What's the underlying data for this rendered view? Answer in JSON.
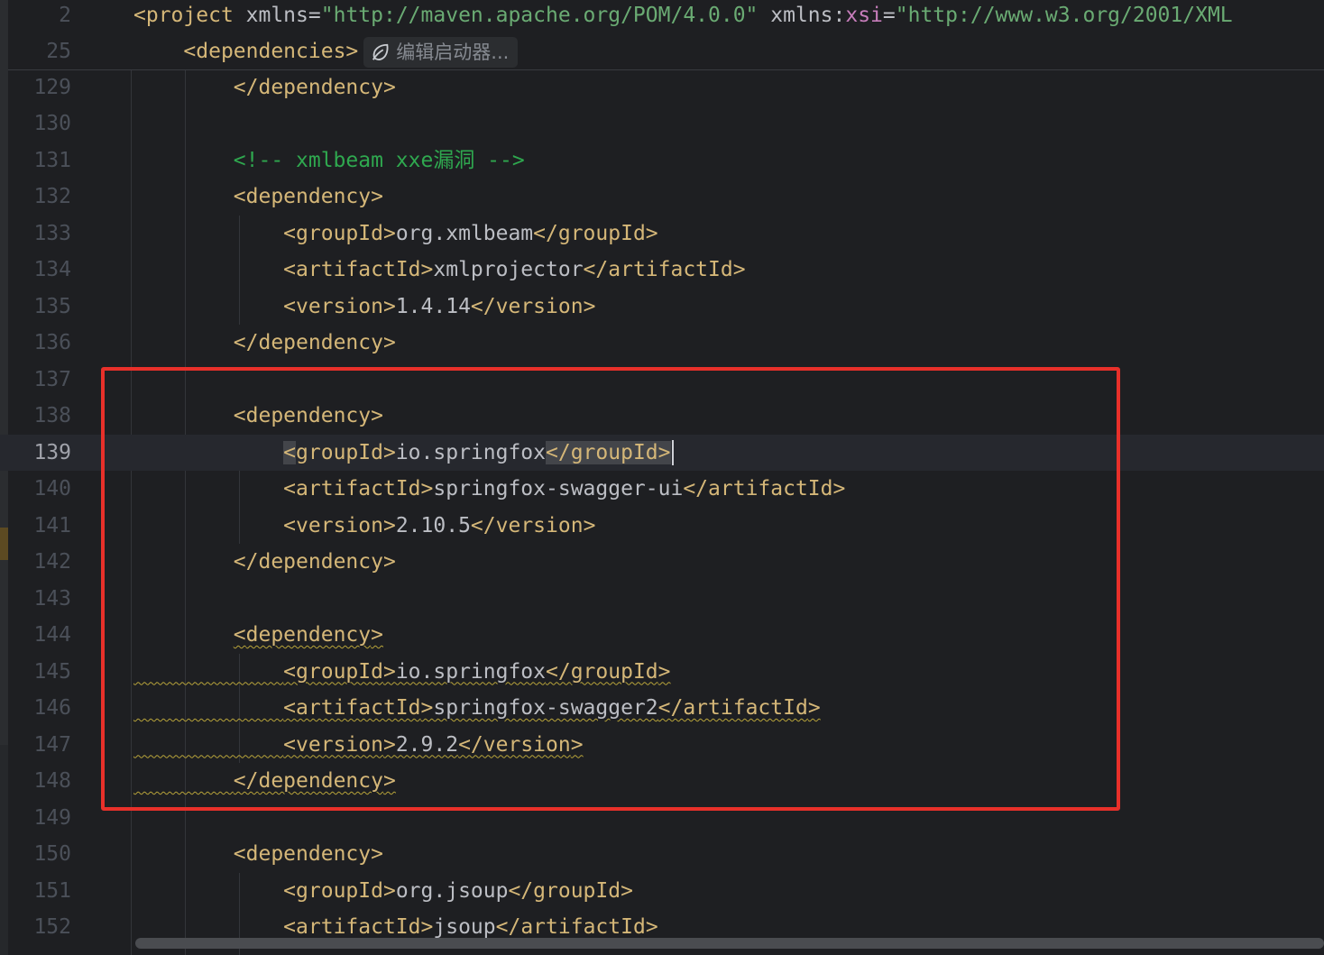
{
  "editor": {
    "sticky_lines": [
      {
        "line_number": "2",
        "tokens": [
          {
            "text": "<",
            "cls": "br"
          },
          {
            "text": "project",
            "cls": "tag"
          },
          {
            "text": " xmlns",
            "cls": "attr"
          },
          {
            "text": "=",
            "cls": "attr"
          },
          {
            "text": "\"http://maven.apache.org/POM/4.0.0\"",
            "cls": "str"
          },
          {
            "text": " xmlns",
            "cls": "attr"
          },
          {
            "text": ":",
            "cls": "attr"
          },
          {
            "text": "xsi",
            "cls": "ns"
          },
          {
            "text": "=",
            "cls": "attr"
          },
          {
            "text": "\"http://www.w3.org/2001/XML",
            "cls": "str"
          }
        ]
      },
      {
        "line_number": "25",
        "indent": "    ",
        "tokens": [
          {
            "text": "<",
            "cls": "br"
          },
          {
            "text": "dependencies",
            "cls": "tag"
          },
          {
            "text": ">",
            "cls": "br"
          }
        ],
        "inlay_hint": "编辑启动器..."
      }
    ],
    "lines": [
      {
        "line_number": "129",
        "indent": "        ",
        "tokens": [
          {
            "text": "</",
            "cls": "br"
          },
          {
            "text": "dependency",
            "cls": "tag"
          },
          {
            "text": ">",
            "cls": "br"
          }
        ]
      },
      {
        "line_number": "130",
        "indent": "",
        "tokens": []
      },
      {
        "line_number": "131",
        "indent": "        ",
        "tokens": [
          {
            "text": "<!-- xmlbeam xxe漏洞 -->",
            "cls": "cmt-g"
          }
        ]
      },
      {
        "line_number": "132",
        "indent": "        ",
        "tokens": [
          {
            "text": "<",
            "cls": "br"
          },
          {
            "text": "dependency",
            "cls": "tag"
          },
          {
            "text": ">",
            "cls": "br"
          }
        ]
      },
      {
        "line_number": "133",
        "indent": "            ",
        "tokens": [
          {
            "text": "<",
            "cls": "br"
          },
          {
            "text": "groupId",
            "cls": "tag"
          },
          {
            "text": ">",
            "cls": "br"
          },
          {
            "text": "org.xmlbeam",
            "cls": "txt"
          },
          {
            "text": "</",
            "cls": "br"
          },
          {
            "text": "groupId",
            "cls": "tag"
          },
          {
            "text": ">",
            "cls": "br"
          }
        ]
      },
      {
        "line_number": "134",
        "indent": "            ",
        "tokens": [
          {
            "text": "<",
            "cls": "br"
          },
          {
            "text": "artifactId",
            "cls": "tag"
          },
          {
            "text": ">",
            "cls": "br"
          },
          {
            "text": "xmlprojector",
            "cls": "txt"
          },
          {
            "text": "</",
            "cls": "br"
          },
          {
            "text": "artifactId",
            "cls": "tag"
          },
          {
            "text": ">",
            "cls": "br"
          }
        ]
      },
      {
        "line_number": "135",
        "indent": "            ",
        "tokens": [
          {
            "text": "<",
            "cls": "br"
          },
          {
            "text": "version",
            "cls": "tag"
          },
          {
            "text": ">",
            "cls": "br"
          },
          {
            "text": "1.4.14",
            "cls": "txt"
          },
          {
            "text": "</",
            "cls": "br"
          },
          {
            "text": "version",
            "cls": "tag"
          },
          {
            "text": ">",
            "cls": "br"
          }
        ]
      },
      {
        "line_number": "136",
        "indent": "        ",
        "tokens": [
          {
            "text": "</",
            "cls": "br"
          },
          {
            "text": "dependency",
            "cls": "tag"
          },
          {
            "text": ">",
            "cls": "br"
          }
        ]
      },
      {
        "line_number": "137",
        "indent": "",
        "tokens": []
      },
      {
        "line_number": "138",
        "indent": "        ",
        "tokens": [
          {
            "text": "<",
            "cls": "br"
          },
          {
            "text": "dependency",
            "cls": "tag"
          },
          {
            "text": ">",
            "cls": "br"
          }
        ]
      },
      {
        "line_number": "139",
        "current": true,
        "indent": "            ",
        "tokens": [
          {
            "text": "<",
            "cls": "br hl"
          },
          {
            "text": "groupId",
            "cls": "tag"
          },
          {
            "text": ">",
            "cls": "br"
          },
          {
            "text": "io.springfox",
            "cls": "txt"
          },
          {
            "text": "</",
            "cls": "br hl"
          },
          {
            "text": "groupId",
            "cls": "tag hl"
          },
          {
            "text": ">",
            "cls": "br hl"
          }
        ],
        "caret": true
      },
      {
        "line_number": "140",
        "indent": "            ",
        "tokens": [
          {
            "text": "<",
            "cls": "br"
          },
          {
            "text": "artifactId",
            "cls": "tag"
          },
          {
            "text": ">",
            "cls": "br"
          },
          {
            "text": "springfox-swagger-ui",
            "cls": "txt"
          },
          {
            "text": "</",
            "cls": "br"
          },
          {
            "text": "artifactId",
            "cls": "tag"
          },
          {
            "text": ">",
            "cls": "br"
          }
        ]
      },
      {
        "line_number": "141",
        "indent": "            ",
        "tokens": [
          {
            "text": "<",
            "cls": "br"
          },
          {
            "text": "version",
            "cls": "tag"
          },
          {
            "text": ">",
            "cls": "br"
          },
          {
            "text": "2.10.5",
            "cls": "txt"
          },
          {
            "text": "</",
            "cls": "br"
          },
          {
            "text": "version",
            "cls": "tag"
          },
          {
            "text": ">",
            "cls": "br"
          }
        ]
      },
      {
        "line_number": "142",
        "indent": "        ",
        "tokens": [
          {
            "text": "</",
            "cls": "br"
          },
          {
            "text": "dependency",
            "cls": "tag"
          },
          {
            "text": ">",
            "cls": "br"
          }
        ]
      },
      {
        "line_number": "143",
        "indent": "",
        "tokens": []
      },
      {
        "line_number": "144",
        "indent": "        ",
        "tokens": [
          {
            "text": "<",
            "cls": "br warn"
          },
          {
            "text": "dependency",
            "cls": "tag warn"
          },
          {
            "text": ">",
            "cls": "br warn"
          }
        ]
      },
      {
        "line_number": "145",
        "indent": "            ",
        "warn_indent": true,
        "tokens": [
          {
            "text": "<",
            "cls": "br warn"
          },
          {
            "text": "groupId",
            "cls": "tag warn"
          },
          {
            "text": ">",
            "cls": "br warn"
          },
          {
            "text": "io.springfox",
            "cls": "txt warn"
          },
          {
            "text": "</",
            "cls": "br warn"
          },
          {
            "text": "groupId",
            "cls": "tag warn"
          },
          {
            "text": ">",
            "cls": "br warn"
          }
        ]
      },
      {
        "line_number": "146",
        "indent": "            ",
        "warn_indent": true,
        "tokens": [
          {
            "text": "<",
            "cls": "br warn"
          },
          {
            "text": "artifactId",
            "cls": "tag warn"
          },
          {
            "text": ">",
            "cls": "br warn"
          },
          {
            "text": "springfox-swagger2",
            "cls": "txt warn"
          },
          {
            "text": "</",
            "cls": "br warn"
          },
          {
            "text": "artifactId",
            "cls": "tag warn"
          },
          {
            "text": ">",
            "cls": "br warn"
          }
        ]
      },
      {
        "line_number": "147",
        "indent": "            ",
        "warn_indent": true,
        "tokens": [
          {
            "text": "<",
            "cls": "br warn"
          },
          {
            "text": "version",
            "cls": "tag warn"
          },
          {
            "text": ">",
            "cls": "br warn"
          },
          {
            "text": "2.9.2",
            "cls": "txt warn"
          },
          {
            "text": "</",
            "cls": "br warn"
          },
          {
            "text": "version",
            "cls": "tag warn"
          },
          {
            "text": ">",
            "cls": "br warn"
          }
        ]
      },
      {
        "line_number": "148",
        "indent": "        ",
        "warn_indent": true,
        "tokens": [
          {
            "text": "</",
            "cls": "br warn"
          },
          {
            "text": "dependency",
            "cls": "tag warn"
          },
          {
            "text": ">",
            "cls": "br warn"
          }
        ]
      },
      {
        "line_number": "149",
        "indent": "",
        "tokens": []
      },
      {
        "line_number": "150",
        "indent": "        ",
        "tokens": [
          {
            "text": "<",
            "cls": "br"
          },
          {
            "text": "dependency",
            "cls": "tag"
          },
          {
            "text": ">",
            "cls": "br"
          }
        ]
      },
      {
        "line_number": "151",
        "indent": "            ",
        "tokens": [
          {
            "text": "<",
            "cls": "br"
          },
          {
            "text": "groupId",
            "cls": "tag"
          },
          {
            "text": ">",
            "cls": "br"
          },
          {
            "text": "org.jsoup",
            "cls": "txt"
          },
          {
            "text": "</",
            "cls": "br"
          },
          {
            "text": "groupId",
            "cls": "tag"
          },
          {
            "text": ">",
            "cls": "br"
          }
        ]
      },
      {
        "line_number": "152",
        "indent": "            ",
        "tokens": [
          {
            "text": "<",
            "cls": "br"
          },
          {
            "text": "artifactId",
            "cls": "tag"
          },
          {
            "text": ">",
            "cls": "br"
          },
          {
            "text": "jsoup",
            "cls": "txt"
          },
          {
            "text": "</",
            "cls": "br"
          },
          {
            "text": "artifactId",
            "cls": "tag"
          },
          {
            "text": ">",
            "cls": "br"
          }
        ]
      }
    ],
    "inlay_icon": "spring-leaf-icon",
    "colors": {
      "background": "#1e1f22",
      "tag": "#d5b778",
      "string": "#6aab73",
      "namespace": "#c77dbb",
      "comment": "#2fa84f",
      "highlight_box": "#e8302a",
      "warning_underline": "#b8a43a"
    }
  }
}
